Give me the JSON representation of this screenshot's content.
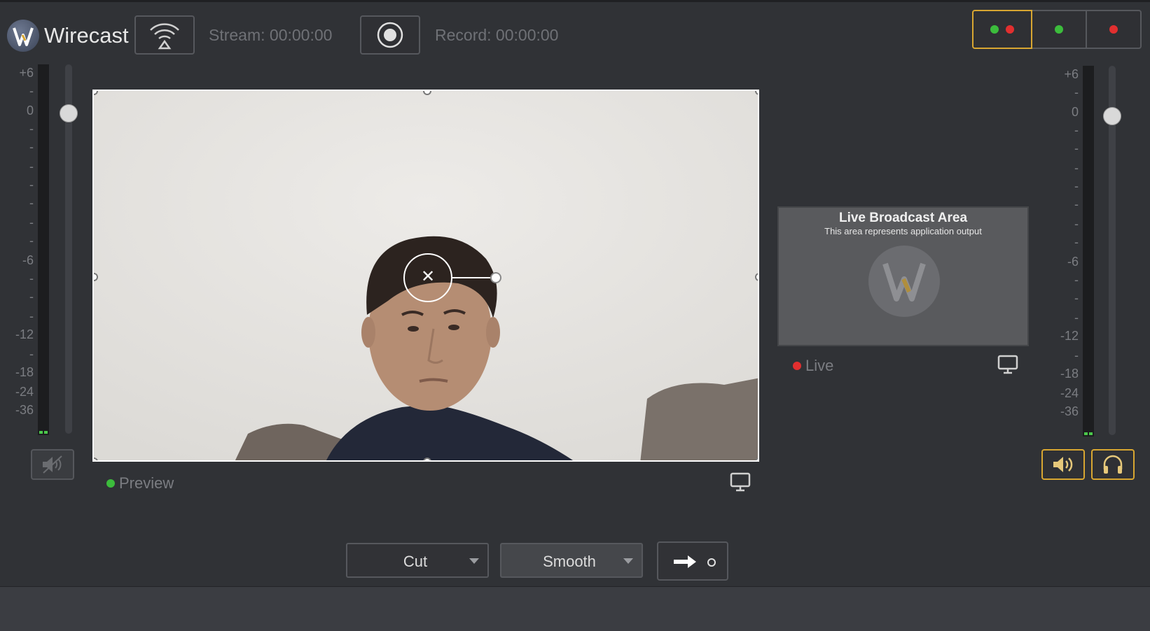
{
  "app": {
    "name": "Wirecast",
    "logo_icon": "wirecast-logo-icon"
  },
  "header": {
    "stream_icon": "broadcast-wifi-icon",
    "stream_timer": "Stream:  00:00:00",
    "record_icon": "record-icon",
    "record_timer": "Record:  00:00:00",
    "layouts": [
      {
        "id": "preview-live",
        "icon": "two-dots-icon",
        "dots": [
          "green",
          "red"
        ],
        "active": true
      },
      {
        "id": "preview-only",
        "icon": "green-dot-icon",
        "dots": [
          "green"
        ],
        "active": false
      },
      {
        "id": "live-only",
        "icon": "red-dot-icon",
        "dots": [
          "red"
        ],
        "active": false
      }
    ]
  },
  "audio": {
    "left_scale": [
      "+6",
      "-",
      "0",
      "-",
      "-",
      "-",
      "-",
      "-",
      "-",
      "-",
      "-6",
      "-",
      "-",
      "-",
      "-12",
      "-",
      "-18",
      "-24",
      "-36"
    ],
    "right_scale": [
      "+6",
      "-",
      "0",
      "-",
      "-",
      "-",
      "-",
      "-",
      "-",
      "-",
      "-6",
      "-",
      "-",
      "-",
      "-12",
      "-",
      "-18",
      "-24",
      "-36"
    ],
    "left_mute_icon": "speaker-muted-icon",
    "right_speaker_icon": "speaker-icon",
    "right_headphones_icon": "headphones-icon"
  },
  "preview": {
    "label": "Preview",
    "status_color": "#3cbc3c",
    "monitor_icon": "monitor-icon"
  },
  "live": {
    "title": "Live Broadcast Area",
    "subtitle": "This area represents application output",
    "label": "Live",
    "status_color": "#e22f2f",
    "monitor_icon": "monitor-icon"
  },
  "transitions": {
    "primary": "Cut",
    "secondary": "Smooth",
    "go_icon": "arrow-right-icon"
  },
  "colors": {
    "accent": "#d8a631",
    "background": "#303236"
  }
}
